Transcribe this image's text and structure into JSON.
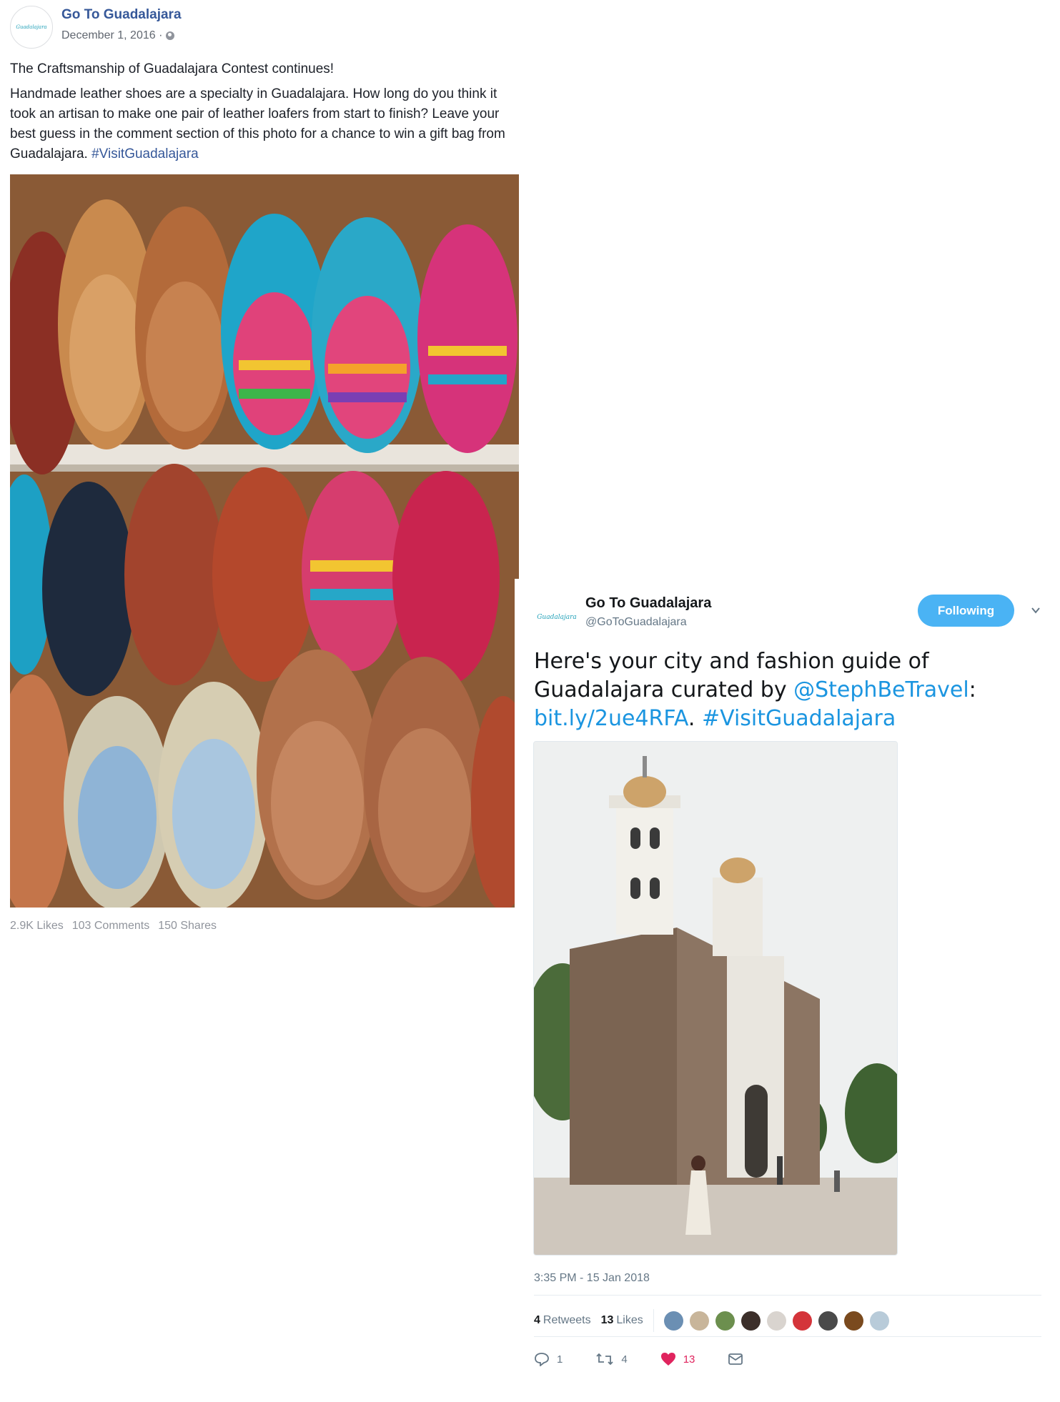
{
  "facebook": {
    "page_name": "Go To Guadalajara",
    "logo_text": "Guadalajara",
    "date": "December 1, 2016 ·",
    "privacy_icon": "globe-icon",
    "paragraph1": "The Craftsmanship of Guadalajara Contest continues!",
    "paragraph2": "Handmade leather shoes are a specialty in Guadalajara. How long do you think it took an artisan to make one pair of leather loafers from start to finish? Leave your best guess in the comment section of this photo for a chance to win a gift bag from Guadalajara.",
    "hashtag": "#VisitGuadalajara",
    "photo_subject": "shelves of handmade woven leather loafers",
    "stats": {
      "likes": "2.9K Likes",
      "comments": "103 Comments",
      "shares": "150 Shares"
    }
  },
  "twitter": {
    "display_name": "Go To Guadalajara",
    "handle": "@GoToGuadalajara",
    "logo_text": "Guadalajara",
    "follow_label": "Following",
    "tweet_text_1": "Here's your city and fashion guide of Guadalajara curated by ",
    "mention": "@StephBeTravel",
    "tweet_text_2": ":",
    "link": "bit.ly/2ue4RFA",
    "tweet_text_3": ". ",
    "hashtag": "#VisitGuadalajara",
    "photo_subject": "colonial stone church with white bell towers and a woman walking in the plaza",
    "timestamp": "3:35 PM - 15 Jan 2018",
    "retweets_count": "4",
    "retweets_label": "Retweets",
    "likes_count": "13",
    "likes_label": "Likes",
    "actions": {
      "reply_count": "1",
      "retweet_count": "4",
      "like_count": "13"
    }
  }
}
